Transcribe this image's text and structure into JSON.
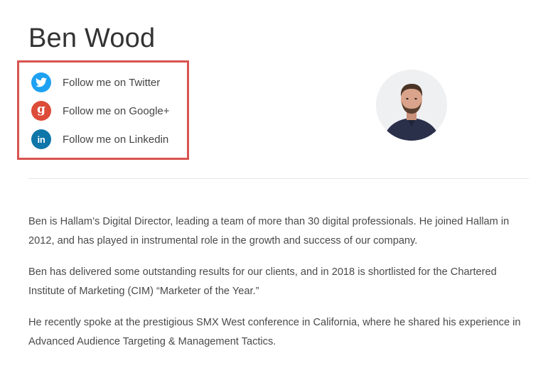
{
  "author": {
    "name": "Ben Wood"
  },
  "social": {
    "items": [
      {
        "label": "Follow me on Twitter",
        "icon": "twitter-icon",
        "color": "#1da1f2"
      },
      {
        "label": "Follow me on Google+",
        "icon": "google-plus-icon",
        "color": "#dd4b39"
      },
      {
        "label": "Follow me on Linkedin",
        "icon": "linkedin-icon",
        "color": "#0e76a8"
      }
    ],
    "highlight_color": "#d9534f"
  },
  "avatar": {
    "icon": "profile-photo"
  },
  "bio": {
    "paragraphs": [
      "Ben is Hallam’s Digital Director, leading a team of more than 30 digital professionals. He joined Hallam in 2012, and has played in instrumental role in the growth and success of our company.",
      "Ben has delivered some outstanding results for our clients, and in 2018 is shortlisted for the Chartered Institute of Marketing (CIM) “Marketer of the Year.”",
      "He recently spoke at the prestigious SMX West conference in California, where he shared his experience in Advanced Audience Targeting & Management Tactics."
    ]
  }
}
